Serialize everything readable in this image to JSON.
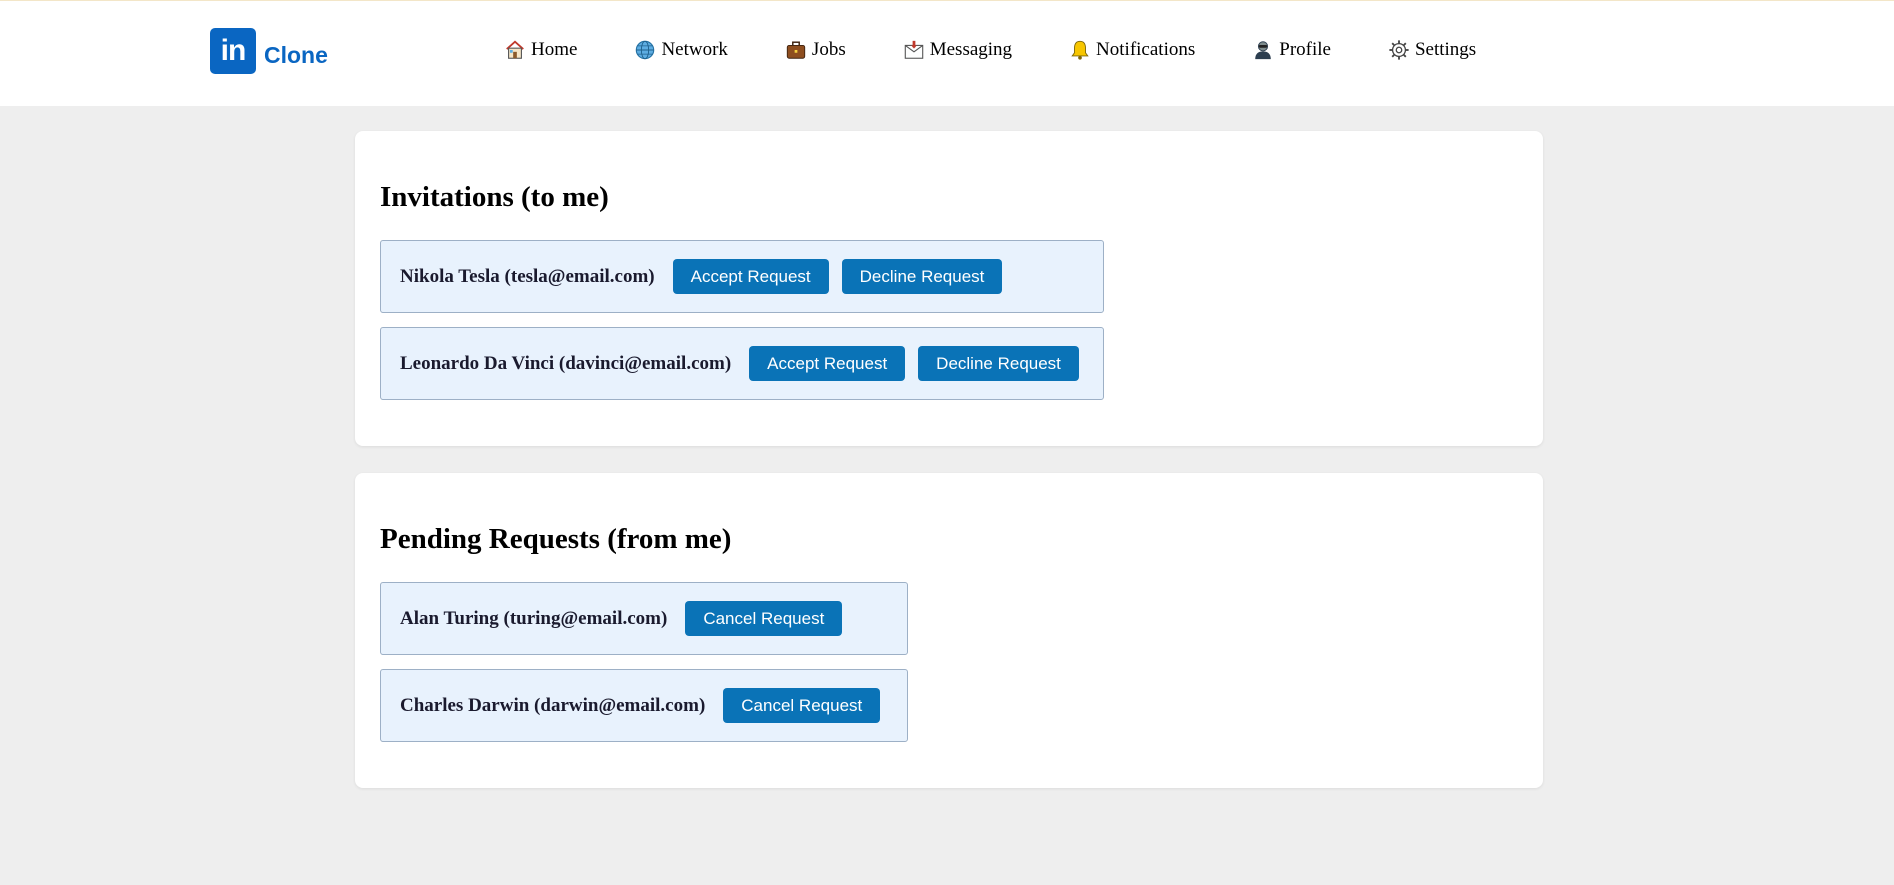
{
  "app": {
    "logo_mark": "in",
    "logo_text": "Clone",
    "brand_color": "#0a66c2",
    "button_color": "#0a73b7"
  },
  "nav": {
    "items": [
      {
        "label": "Home",
        "icon": "home-icon"
      },
      {
        "label": "Network",
        "icon": "globe-icon"
      },
      {
        "label": "Jobs",
        "icon": "briefcase-icon"
      },
      {
        "label": "Messaging",
        "icon": "envelope-icon"
      },
      {
        "label": "Notifications",
        "icon": "bell-icon"
      },
      {
        "label": "Profile",
        "icon": "person-icon"
      },
      {
        "label": "Settings",
        "icon": "gear-icon"
      }
    ]
  },
  "invitations": {
    "title": "Invitations (to me)",
    "items": [
      {
        "name": "Nikola Tesla (tesla@email.com)",
        "accept_label": "Accept Request",
        "decline_label": "Decline Request"
      },
      {
        "name": "Leonardo Da Vinci (davinci@email.com)",
        "accept_label": "Accept Request",
        "decline_label": "Decline Request"
      }
    ]
  },
  "pending": {
    "title": "Pending Requests (from me)",
    "items": [
      {
        "name": "Alan Turing (turing@email.com)",
        "cancel_label": "Cancel Request"
      },
      {
        "name": "Charles Darwin (darwin@email.com)",
        "cancel_label": "Cancel Request"
      }
    ]
  }
}
